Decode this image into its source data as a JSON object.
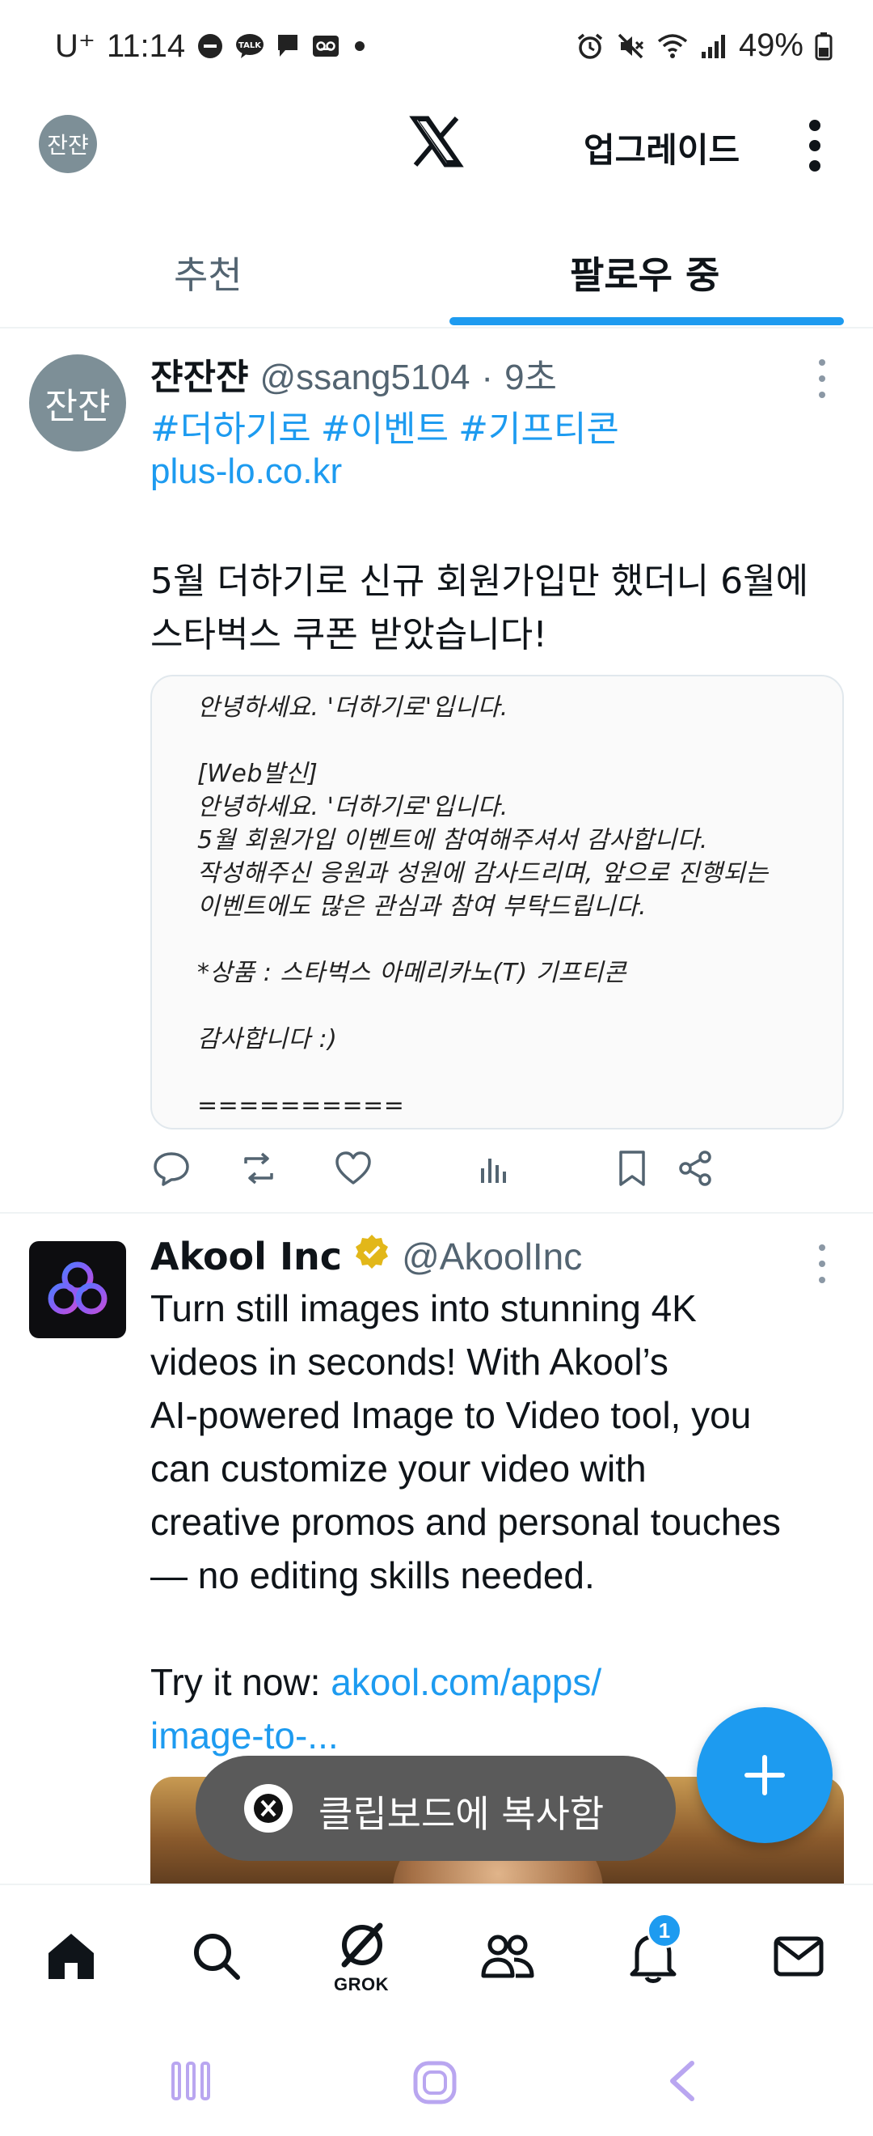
{
  "status_bar": {
    "carrier": "U⁺",
    "time": "11:14",
    "battery": "49%",
    "left_icons": [
      "minus-circle-icon",
      "talk-icon",
      "chat-bubble-icon",
      "voicemail-icon",
      "dot-icon"
    ],
    "right_icons": [
      "alarm-icon",
      "mute-icon",
      "wifi-icon",
      "signal-icon",
      "battery-icon"
    ]
  },
  "header": {
    "avatar_text": "잔쟌",
    "logo": "x-logo-icon",
    "upgrade_label": "업그레이드",
    "more_icon": "more-vertical-icon"
  },
  "tabs": [
    {
      "label": "추천",
      "active": false
    },
    {
      "label": "팔로우 중",
      "active": true
    }
  ],
  "tweets": [
    {
      "avatar_text": "잔쟌",
      "name": "쟌잔쟌",
      "handle": "@ssang5104",
      "separator": "·",
      "time": "9초",
      "hashtags": [
        "#더하기로",
        "#이벤트",
        "#기프티콘"
      ],
      "link": "plus-lo.co.kr",
      "text_lines": [
        "5월 더하기로 신규 회원가입만 했더니 6월에",
        "스타벅스 쿠폰 받았습니다!"
      ],
      "image_text": "안녕하세요. '더하기로'입니다.\n\n[Web발신]\n안녕하세요. '더하기로'입니다.\n5월 회원가입 이벤트에 참여해주셔서 감사합니다.\n작성해주신 응원과 성원에 감사드리며, 앞으로 진행되는\n이벤트에도 많은 관심과 참여 부탁드립니다.\n\n*상품 : 스타벅스 아메리카노(T) 기프티콘\n\n감사합니다 :)\n\n=========="
    },
    {
      "name": "Akool Inc",
      "handle": "@AkoolInc",
      "verified": true,
      "text_lines": [
        "Turn still images into stunning 4K",
        "videos in seconds! With Akool’s",
        "AI-powered Image to Video tool, you",
        "can customize your video with",
        "creative promos and personal touches",
        "— no editing skills needed."
      ],
      "cta_prefix": "Try it now: ",
      "cta_link_1": "akool.com/apps/",
      "cta_link_2": "image-to-..."
    }
  ],
  "toast": {
    "text": "클립보드에 복사함"
  },
  "bottom_nav": {
    "items": [
      "home-icon",
      "search-icon",
      "grok-icon",
      "communities-icon",
      "notifications-icon",
      "messages-icon"
    ],
    "grok_label": "GROK",
    "notification_badge": "1"
  },
  "colors": {
    "accent": "#1d9bf0",
    "text": "#0f1419",
    "secondary_text": "#536471",
    "toast_bg": "#5a5a5a",
    "system_nav": "#b9a6f0"
  }
}
